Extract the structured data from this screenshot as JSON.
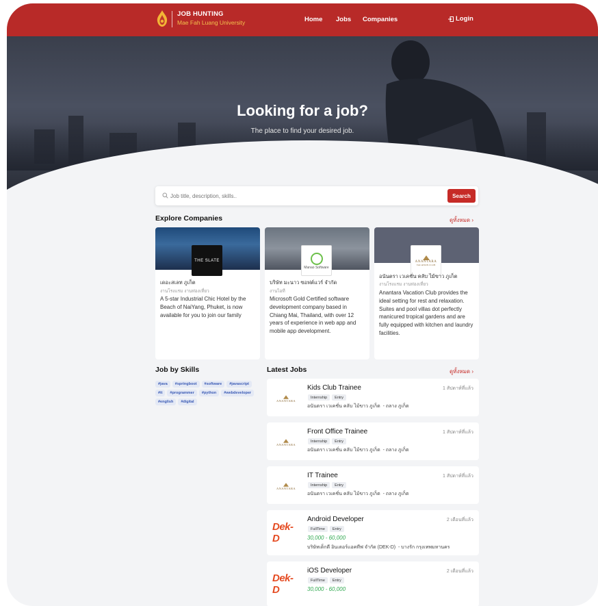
{
  "nav": {
    "brand_title": "JOB HUNTING",
    "brand_subtitle": "Mae Fah Luang University",
    "links": [
      "Home",
      "Jobs",
      "Companies"
    ],
    "login": "Login"
  },
  "hero": {
    "title": "Looking for a job?",
    "subtitle": "The place to find your desired job."
  },
  "search": {
    "placeholder": "Job title, description, skills..",
    "button": "Search"
  },
  "explore": {
    "title": "Explore Companies",
    "see_all": "ดูทั้งหมด",
    "companies": [
      {
        "logo_text": "THE SLATE",
        "name": "เดอะสเลท ภูเก็ต",
        "category": "งานโรงแรม งานท่องเที่ยว",
        "description": "A 5-star Industrial Chic Hotel by the Beach of NaiYang, Phuket, is now available for you to join our family"
      },
      {
        "logo_text": "Manao Software",
        "name": "บริษัท มะนาว ซอฟต์แวร์ จำกัด",
        "category": "งานไอที",
        "description": "Microsoft Gold Certified software development company based in Chiang Mai, Thailand, with over 12 years of experience in web app and mobile app development."
      },
      {
        "logo_text": "ANANTARA",
        "logo_sub": "VACATION CLUB",
        "name": "อนันตรา เวเคชั่น คลับ ไม้ขาว ภูเก็ต",
        "category": "งานโรงแรม งานท่องเที่ยว",
        "description": "Anantara Vacation Club provides the ideal setting for rest and relaxation. Suites and pool villas dot perfectly manicured tropical gardens and are fully equipped with kitchen and laundry facilities."
      }
    ]
  },
  "skills": {
    "title": "Job by Skills",
    "tags": [
      "#java",
      "#springboot",
      "#software",
      "#javascript",
      "#it",
      "#programmer",
      "#python",
      "#webdeveloper",
      "#english",
      "#digital"
    ]
  },
  "latest": {
    "title": "Latest Jobs",
    "see_all": "ดูทั้งหมด",
    "jobs": [
      {
        "title": "Kids Club Trainee",
        "time": "1 สัปดาห์ที่แล้ว",
        "tags": [
          "Internship",
          "Entry"
        ],
        "salary": "",
        "company": "อนันตรา เวเคชั่น คลับ ไม้ขาว ภูเก็ต",
        "location": "ถลาง ภูเก็ต",
        "logo": "anantara"
      },
      {
        "title": "Front Office Trainee",
        "time": "1 สัปดาห์ที่แล้ว",
        "tags": [
          "Internship",
          "Entry"
        ],
        "salary": "",
        "company": "อนันตรา เวเคชั่น คลับ ไม้ขาว ภูเก็ต",
        "location": "ถลาง ภูเก็ต",
        "logo": "anantara"
      },
      {
        "title": "IT Trainee",
        "time": "1 สัปดาห์ที่แล้ว",
        "tags": [
          "Internship",
          "Entry"
        ],
        "salary": "",
        "company": "อนันตรา เวเคชั่น คลับ ไม้ขาว ภูเก็ต",
        "location": "ถลาง ภูเก็ต",
        "logo": "anantara"
      },
      {
        "title": "Android Developer",
        "time": "2 เดือนที่แล้ว",
        "tags": [
          "FullTime",
          "Entry"
        ],
        "salary": "30,000  - 60,000",
        "company": "บริษัทเด็กดี อินเตอร์แอคทีฟ จำกัด (DEK-D)",
        "location": "บางรัก กรุงเทพมหานคร",
        "logo": "dekd"
      },
      {
        "title": "iOS Developer",
        "time": "2 เดือนที่แล้ว",
        "tags": [
          "FullTime",
          "Entry"
        ],
        "salary": "30,000  - 60,000",
        "company": "",
        "location": "",
        "logo": "dekd"
      }
    ]
  },
  "colors": {
    "brand_red": "#b82a28",
    "accent_gold": "#f4c24d",
    "salary_green": "#2fa84f"
  }
}
